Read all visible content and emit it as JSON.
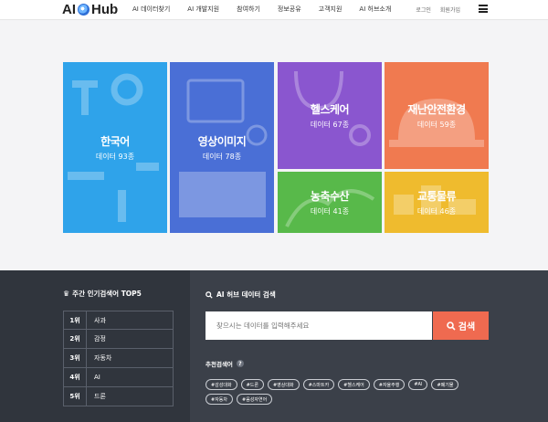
{
  "header": {
    "logo_text_left": "AI",
    "logo_text_right": "Hub",
    "nav": [
      "AI 데이터찾기",
      "AI 개발지원",
      "참여하기",
      "정보공유",
      "고객지원",
      "AI 허브소개"
    ],
    "login": "로그인",
    "signup": "회원가입",
    "menu_icon": "hamburger-icon"
  },
  "tiles": {
    "korean": {
      "title": "한국어",
      "count": "데이터 93종",
      "color": "#2fa3ea"
    },
    "image": {
      "title": "영상이미지",
      "count": "데이터 78종",
      "color": "#4a6fd6"
    },
    "health": {
      "title": "헬스케어",
      "count": "데이터 67종",
      "color": "#8a56cf"
    },
    "safety": {
      "title": "재난안전환경",
      "count": "데이터 59종",
      "color": "#f07a50"
    },
    "agri": {
      "title": "농축수산",
      "count": "데이터 41종",
      "color": "#58b94a"
    },
    "traffic": {
      "title": "교통물류",
      "count": "데이터 46종",
      "color": "#efbb2e"
    }
  },
  "top5": {
    "title": "주간 인기검색어 TOP5",
    "icon": "crown-icon",
    "items": [
      {
        "rank": "1위",
        "word": "사과"
      },
      {
        "rank": "2위",
        "word": "감정"
      },
      {
        "rank": "3위",
        "word": "자동차"
      },
      {
        "rank": "4위",
        "word": "AI"
      },
      {
        "rank": "5위",
        "word": "드론"
      }
    ]
  },
  "search": {
    "title": "AI 허브 데이터 검색",
    "placeholder": "찾으시는 데이터를 입력해주세요",
    "button": "검색",
    "rec_title": "추천검색어",
    "tags": [
      "#감성대화",
      "#드론",
      "#영상대화",
      "#스마트카",
      "#헬스케어",
      "#자율주행",
      "#AI",
      "#폐기물",
      "#자동차",
      "#음성자연어"
    ]
  }
}
